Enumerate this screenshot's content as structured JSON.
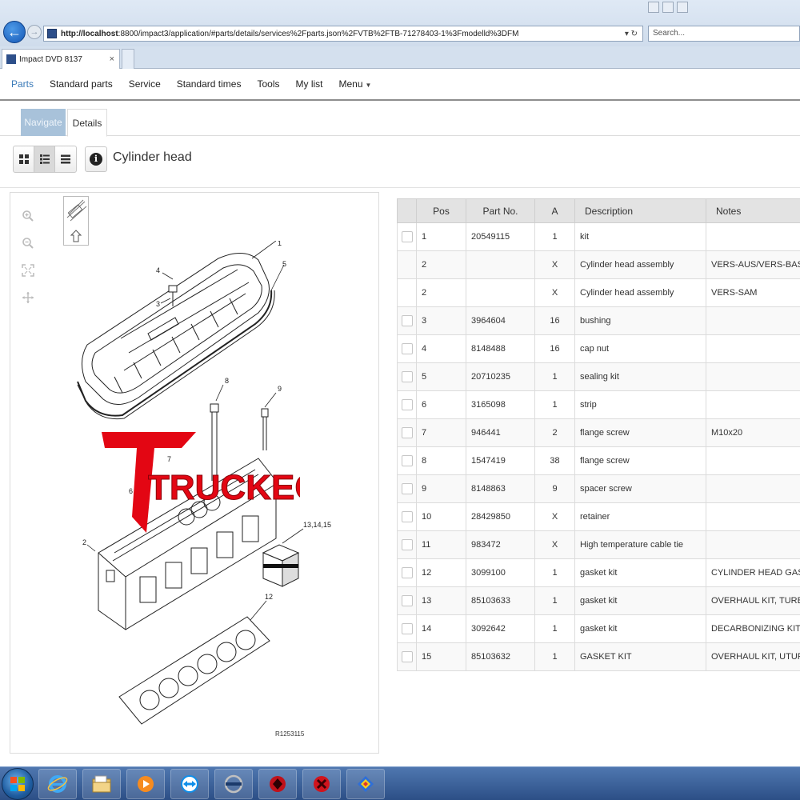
{
  "browser": {
    "address_host": "http://localhost",
    "address_rest": ":8800/impact3/application/#parts/details/services%2Fparts.json%2FVTB%2FTB-71278403-1%3Fmodelld%3DFM",
    "address_controls": "▾ ↻",
    "search_placeholder": "Search...",
    "tab_title": "Impact DVD 8137",
    "tab_close": "×"
  },
  "nav": {
    "parts": "Parts",
    "standard_parts": "Standard parts",
    "service": "Service",
    "standard_times": "Standard times",
    "tools": "Tools",
    "my_list": "My list",
    "menu": "Menu"
  },
  "subtabs": {
    "navigate": "Navigate",
    "details": "Details"
  },
  "page": {
    "title": "Cylinder head"
  },
  "diagram": {
    "labels": {
      "l1": "1",
      "l2": "2",
      "l3": "3",
      "l4": "4",
      "l5": "5",
      "l6": "6",
      "l7": "7",
      "l8": "8",
      "l9": "9",
      "l12": "12",
      "l131415": "13,14,15"
    },
    "drawing_ref": "R1253115",
    "watermark": "TRUCKECU",
    "watermark_color": "#e30613"
  },
  "table": {
    "headers": {
      "pos": "Pos",
      "part_no": "Part No.",
      "a": "A",
      "description": "Description",
      "notes": "Notes"
    },
    "rows": [
      {
        "checkbox": true,
        "pos": "1",
        "part_no": "20549115",
        "a": "1",
        "description": "kit",
        "notes": ""
      },
      {
        "checkbox": false,
        "pos": "2",
        "part_no": "",
        "a": "X",
        "description": "Cylinder head assembly",
        "notes": "VERS-AUS/VERS-BAS"
      },
      {
        "checkbox": false,
        "pos": "2",
        "part_no": "",
        "a": "X",
        "description": "Cylinder head assembly",
        "notes": "VERS-SAM"
      },
      {
        "checkbox": true,
        "pos": "3",
        "part_no": "3964604",
        "a": "16",
        "description": "bushing",
        "notes": ""
      },
      {
        "checkbox": true,
        "pos": "4",
        "part_no": "8148488",
        "a": "16",
        "description": "cap nut",
        "notes": ""
      },
      {
        "checkbox": true,
        "pos": "5",
        "part_no": "20710235",
        "a": "1",
        "description": "sealing kit",
        "notes": ""
      },
      {
        "checkbox": true,
        "pos": "6",
        "part_no": "3165098",
        "a": "1",
        "description": "strip",
        "notes": ""
      },
      {
        "checkbox": true,
        "pos": "7",
        "part_no": "946441",
        "a": "2",
        "description": "flange screw",
        "notes": "M10x20"
      },
      {
        "checkbox": true,
        "pos": "8",
        "part_no": "1547419",
        "a": "38",
        "description": "flange screw",
        "notes": ""
      },
      {
        "checkbox": true,
        "pos": "9",
        "part_no": "8148863",
        "a": "9",
        "description": "spacer screw",
        "notes": ""
      },
      {
        "checkbox": true,
        "pos": "10",
        "part_no": "28429850",
        "a": "X",
        "description": "retainer",
        "notes": ""
      },
      {
        "checkbox": true,
        "pos": "11",
        "part_no": "983472",
        "a": "X",
        "description": "High temperature cable tie",
        "notes": ""
      },
      {
        "checkbox": true,
        "pos": "12",
        "part_no": "3099100",
        "a": "1",
        "description": "gasket kit",
        "notes": "CYLINDER HEAD GASKET KIT"
      },
      {
        "checkbox": true,
        "pos": "13",
        "part_no": "85103633",
        "a": "1",
        "description": "gasket kit",
        "notes": "OVERHAUL KIT, TURBO-C"
      },
      {
        "checkbox": true,
        "pos": "14",
        "part_no": "3092642",
        "a": "1",
        "description": "gasket kit",
        "notes": "DECARBONIZING KIT"
      },
      {
        "checkbox": true,
        "pos": "15",
        "part_no": "85103632",
        "a": "1",
        "description": "GASKET KIT",
        "notes": "OVERHAUL KIT, UTURBOC"
      }
    ]
  },
  "taskbar": {
    "icons": [
      "start-orb-icon",
      "internet-explorer-icon",
      "file-explorer-icon",
      "media-player-icon",
      "teamviewer-icon",
      "volvo-icon",
      "red-app-icon",
      "red-app-icon-2",
      "color-app-icon"
    ]
  },
  "colors": {
    "accent": "#3a7ab8",
    "taskbar": "#2c4f86",
    "nav_tab_inactive": "#a8c2da"
  }
}
